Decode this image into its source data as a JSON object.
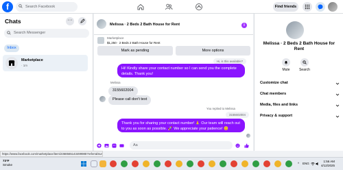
{
  "topbar": {
    "logo": "f",
    "search_placeholder": "Search Facebook",
    "find_friends": "Find friends"
  },
  "sidebar": {
    "title": "Chats",
    "more_btn": "···",
    "search_placeholder": "Search Messenger",
    "inbox_label": "Inbox",
    "conversation": {
      "name": "Marketplace",
      "sub": "· 1m"
    }
  },
  "chat": {
    "header_name": "Melissa · 2 Beds 2 Bath House for Rent",
    "info_icon": "i",
    "marketplace_label": "Marketplace",
    "listing": "$1,250 · 2 Beds 2 Bath House for Rent",
    "mark_pending": "Mark as pending",
    "more_options": "More options",
    "messages": {
      "reply_preview": "Hi, is this available?",
      "msg1": "Hi! Kindly share your contact number so I can send you the complete details. Thank you!",
      "sender_name": "Melissa",
      "msg2": "3155602004",
      "msg3": "Please call don't text",
      "replied_to": "You replied to Melissa",
      "reply_quote": "3155602004",
      "msg4": "Thank you for sharing your contact number! 🙏 Our team will reach out to you as soon as possible. 🚀 We appreciate your patience! 😊"
    },
    "composer_placeholder": "Aa"
  },
  "rightpanel": {
    "name": "Melissa · 2 Beds 2 Bath House for Rent",
    "mute": "Mute",
    "search": "Search",
    "sections": [
      "Customize chat",
      "Chat members",
      "Media, files and links",
      "Privacy & support"
    ]
  },
  "status_url": "https://www.facebook.com/marketplace/item/2368565143499985?referralSurfac...",
  "taskbar": {
    "temp": "73°F",
    "weather": "Smoke",
    "time": "1:56 AM",
    "date": "4/12/2025",
    "lang": "ENG"
  },
  "colors": {
    "brand": "#0866ff",
    "bubble_out": "#8a14ff",
    "bubble_in": "#e4e6eb"
  }
}
